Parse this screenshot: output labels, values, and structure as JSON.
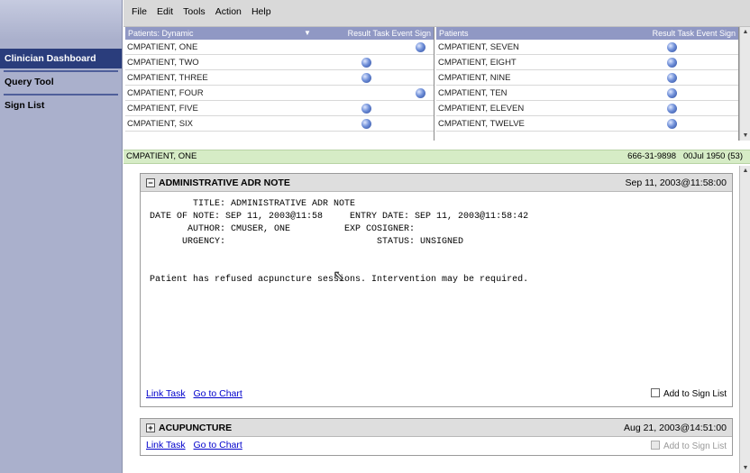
{
  "sidebar": {
    "items": [
      {
        "label": "Clinician Dashboard"
      },
      {
        "label": "Query Tool"
      },
      {
        "label": "Sign List"
      }
    ]
  },
  "menubar": {
    "items": [
      "File",
      "Edit",
      "Tools",
      "Action",
      "Help"
    ]
  },
  "patients_left": {
    "header": "Patients: Dynamic",
    "columns": "Result Task Event Sign",
    "rows": [
      {
        "name": "CMPATIENT, ONE",
        "indicator": "sign"
      },
      {
        "name": "CMPATIENT, TWO",
        "indicator": "task"
      },
      {
        "name": "CMPATIENT, THREE",
        "indicator": "task"
      },
      {
        "name": "CMPATIENT, FOUR",
        "indicator": "sign"
      },
      {
        "name": "CMPATIENT, FIVE",
        "indicator": "task"
      },
      {
        "name": "CMPATIENT, SIX",
        "indicator": "task"
      }
    ]
  },
  "patients_right": {
    "header": "Patients",
    "columns": "Result Task Event Sign",
    "rows": [
      {
        "name": "CMPATIENT, SEVEN",
        "indicator": "task"
      },
      {
        "name": "CMPATIENT, EIGHT",
        "indicator": "task"
      },
      {
        "name": "CMPATIENT, NINE",
        "indicator": "task"
      },
      {
        "name": "CMPATIENT, TEN",
        "indicator": "task"
      },
      {
        "name": "CMPATIENT, ELEVEN",
        "indicator": "task"
      },
      {
        "name": "CMPATIENT, TWELVE",
        "indicator": "task"
      }
    ]
  },
  "patient_bar": {
    "name": "CMPATIENT, ONE",
    "ssn": "666-31-9898",
    "dob": "00Jul 1950 (53)"
  },
  "notes": [
    {
      "title": "ADMINISTRATIVE ADR NOTE",
      "datetime": "Sep 11, 2003@11:58:00",
      "toggle": "−",
      "lines": [
        "        TITLE: ADMINISTRATIVE ADR NOTE",
        "DATE OF NOTE: SEP 11, 2003@11:58     ENTRY DATE: SEP 11, 2003@11:58:42",
        "       AUTHOR: CMUSER, ONE          EXP COSIGNER:",
        "      URGENCY:                            STATUS: UNSIGNED",
        "",
        "",
        "Patient has refused acpuncture sessions. Intervention may be required."
      ],
      "link_task": "Link Task",
      "go_to_chart": "Go to Chart",
      "add_to_sign_list": "Add to Sign List"
    },
    {
      "title": "ACUPUNCTURE",
      "datetime": "Aug 21, 2003@14:51:00",
      "toggle": "+",
      "link_task": "Link Task",
      "go_to_chart": "Go to Chart",
      "add_to_sign_list": "Add to Sign List"
    }
  ],
  "icons": {
    "orb": "status-orb-icon",
    "scroll_up": "▲",
    "scroll_down": "▼",
    "dropdown": "▼"
  },
  "colors": {
    "sidebar_bg": "#aab0cc",
    "active_nav": "#2a3d7c",
    "list_header": "#9098c4",
    "patient_bar": "#d6ecc6",
    "link": "#0000cc"
  }
}
